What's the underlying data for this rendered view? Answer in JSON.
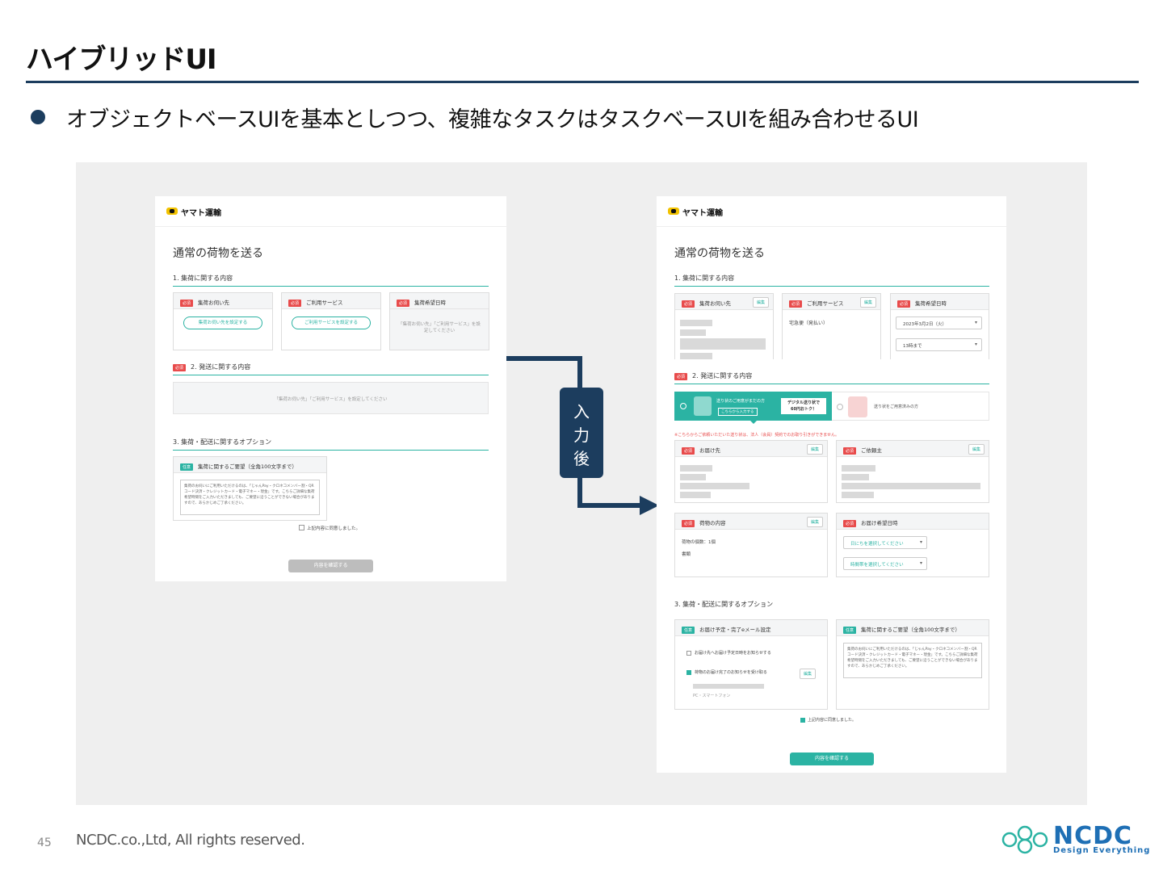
{
  "slide": {
    "title": "ハイブリッドUI",
    "bullet": "オブジェクトベースUIを基本としつつ、複雑なタスクはタスクベースUIを組み合わせるUI",
    "page_number": "45",
    "copyright": "NCDC.co.,Ltd, All rights reserved.",
    "brand_word": "NCDC",
    "brand_tagline": "Design Everything",
    "arrow_label": "入力後"
  },
  "colors": {
    "navy": "#1c3d5e",
    "teal": "#2bb3a3",
    "red": "#e84b4b",
    "brand_blue": "#1e6fb5"
  },
  "shared": {
    "logo": "ヤマト運輸",
    "page_title": "通常の荷物を送る",
    "tag_required": "必須",
    "tag_optional": "任意",
    "edit": "編集",
    "card_pickup": "集荷お伺い先",
    "card_service": "ご利用サービス",
    "card_date": "集荷希望日時",
    "sec2_title": "2. 発送に関する内容",
    "sec3_title": "3. 集荷・配送に関するオプション",
    "agree": "上記内容に同意しました。",
    "confirm_btn": "内容を確認する",
    "request_card": "集荷に関するご要望（全角100文字まで）",
    "request_text": "集荷のお伺いにご利用いただけるのは、「じゃんPay・クロネコメンバー割・QRコード決済・クレジットカード・電子マネー・現金」です。こちらご詳細な集荷希望時間をご入力いただきましても、ご要望に沿うことができない場合がありますので、あらかじめご了承ください。"
  },
  "before": {
    "sec1_title": "1. 集荷に関する内容",
    "btn_pickup": "集荷お伺い先を設定する",
    "btn_service": "ご利用サービスを設定する",
    "date_hint": "「集荷お伺い先」「ご利用サービス」を設定してください",
    "sec2_hint": "「集荷お伺い先」「ご利用サービス」を設定してください"
  },
  "after": {
    "sec1_title": "1. 集荷に関する内容",
    "service_value": "宅急便（発払い）",
    "date_value": "2023年3月2日（火）",
    "time_value": "13時まで",
    "opt_left": "送り状のご用意がまだの方",
    "opt_left_sub": "こちらから入力する",
    "opt_promo_1": "デジタル送り状で",
    "opt_promo_2": "60円おトク！",
    "opt_right": "送り状をご用意済みの方",
    "notice": "※こちらからご依頼いただいた送り状は、法人（会員）契約でのお取り引きができません。",
    "card_dest": "お届け先",
    "card_sender": "ご依頼主",
    "card_goods": "荷物の内容",
    "card_delivery": "お届け希望日時",
    "goods_line1": "荷物の個数：1個",
    "goods_line2": "書類",
    "sel_date": "日にちを選択してください",
    "sel_time": "時間帯を選択してください",
    "notify_card": "お届け予定・完了eメール設定",
    "notify_1": "お届け先へお届け予定日時をお知らせする",
    "notify_2": "荷物のお届け完了のお知らせを受け取る",
    "notify_device": "PC・スマートフォン"
  }
}
